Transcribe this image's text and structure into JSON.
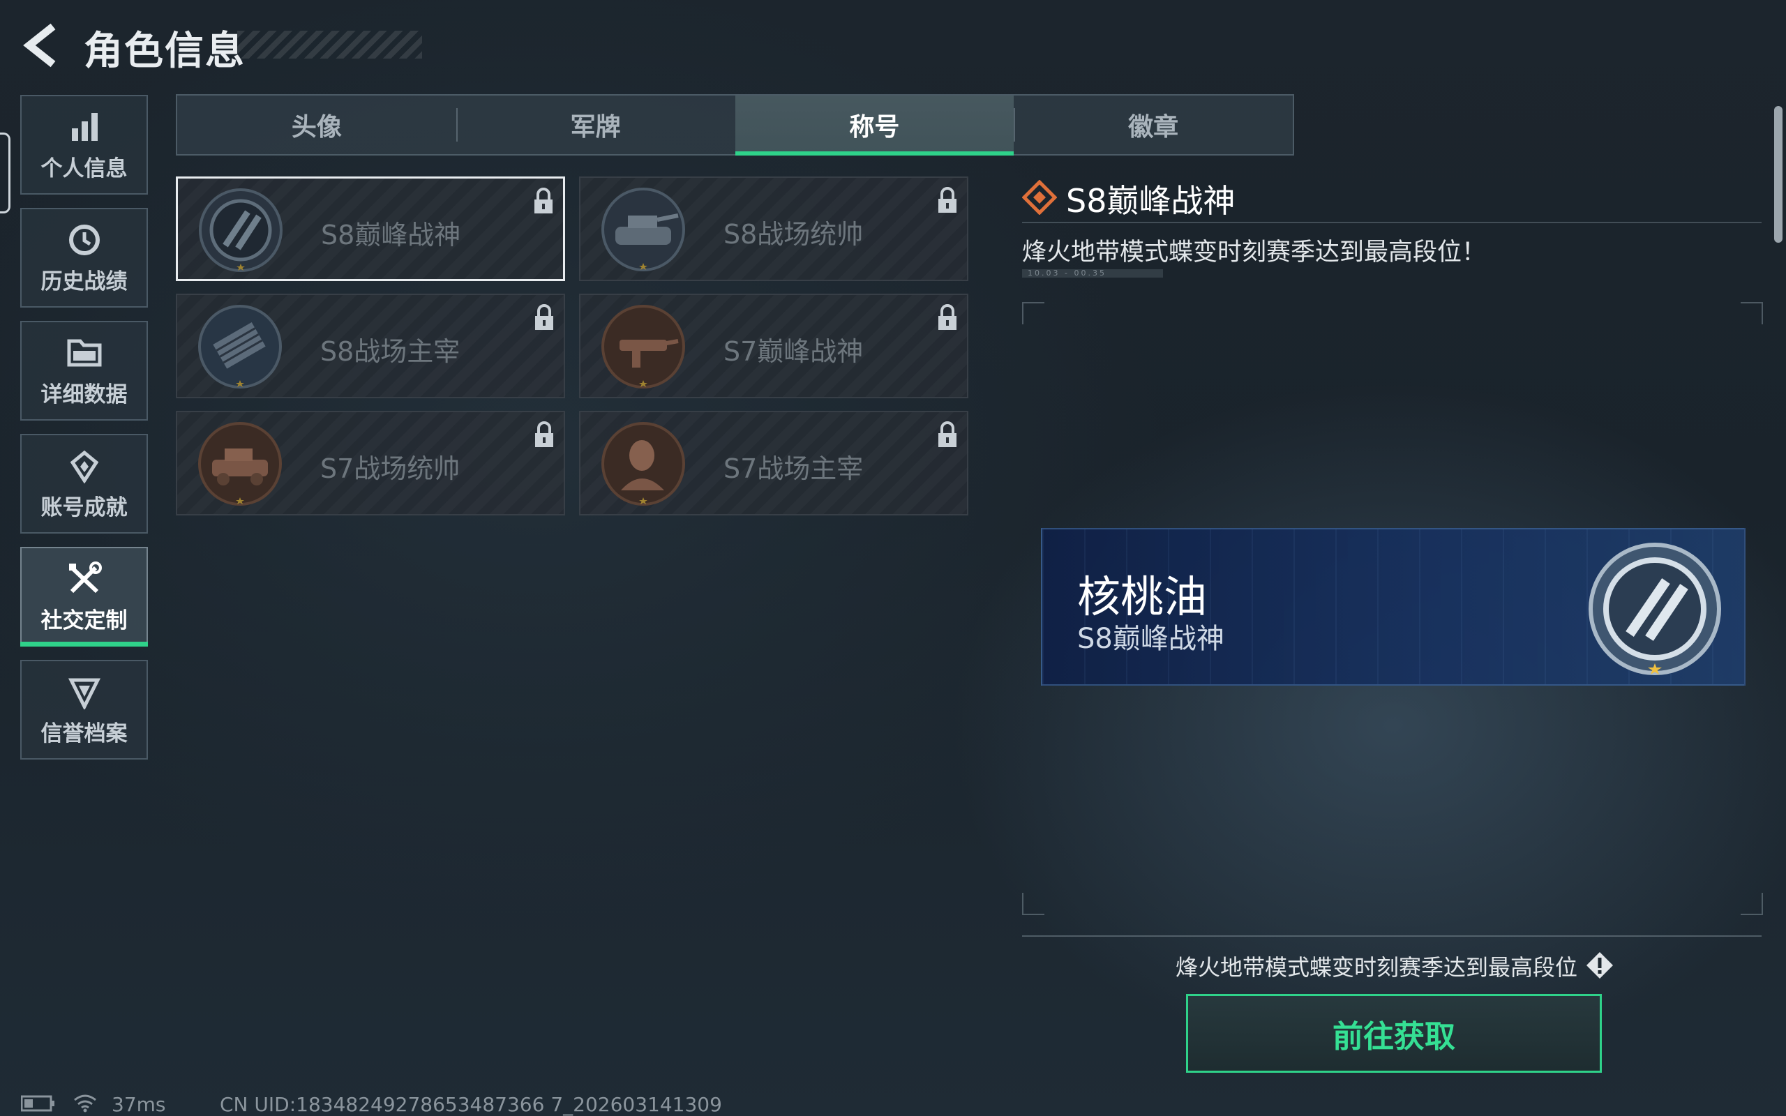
{
  "header": {
    "title": "角色信息"
  },
  "sidebar": {
    "items": [
      {
        "label": "个人信息",
        "icon": "bar-chart-icon"
      },
      {
        "label": "历史战绩",
        "icon": "history-clock-icon"
      },
      {
        "label": "详细数据",
        "icon": "folder-icon"
      },
      {
        "label": "账号成就",
        "icon": "achievement-badge-icon"
      },
      {
        "label": "社交定制",
        "icon": "tools-icon",
        "active": true
      },
      {
        "label": "信誉档案",
        "icon": "reputation-shield-icon"
      }
    ]
  },
  "tabs": [
    {
      "label": "头像"
    },
    {
      "label": "军牌"
    },
    {
      "label": "称号",
      "active": true
    },
    {
      "label": "徽章"
    }
  ],
  "titles": [
    {
      "name": "S8巅峰战神",
      "locked": true,
      "selected": true,
      "badge": "s8-peak-god-emblem-icon"
    },
    {
      "name": "S8战场统帅",
      "locked": true,
      "badge": "s8-tank-emblem-icon"
    },
    {
      "name": "S8战场主宰",
      "locked": true,
      "badge": "s8-rocket-emblem-icon"
    },
    {
      "name": "S7巅峰战神",
      "locked": true,
      "badge": "s7-peak-god-emblem-icon"
    },
    {
      "name": "S7战场统帅",
      "locked": true,
      "badge": "s7-vehicle-emblem-icon"
    },
    {
      "name": "S7战场主宰",
      "locked": true,
      "badge": "s7-soldier-emblem-icon"
    }
  ],
  "detail": {
    "title": "S8巅峰战神",
    "description": "烽火地带模式蝶变时刻赛季达到最高段位！",
    "date_range": "10.03 - 00.35",
    "preview": {
      "player_name": "核桃油",
      "title": "S8巅峰战神"
    },
    "requirement": "烽火地带模式蝶变时刻赛季达到最高段位",
    "button_label": "前往获取"
  },
  "status_bar": {
    "ping": "37ms",
    "uid": "CN UID:18348249278653487366 7_202603141309"
  },
  "colors": {
    "accent": "#2fd28a",
    "title_icon": "#e0703a",
    "preview_bg": "#16305f"
  }
}
